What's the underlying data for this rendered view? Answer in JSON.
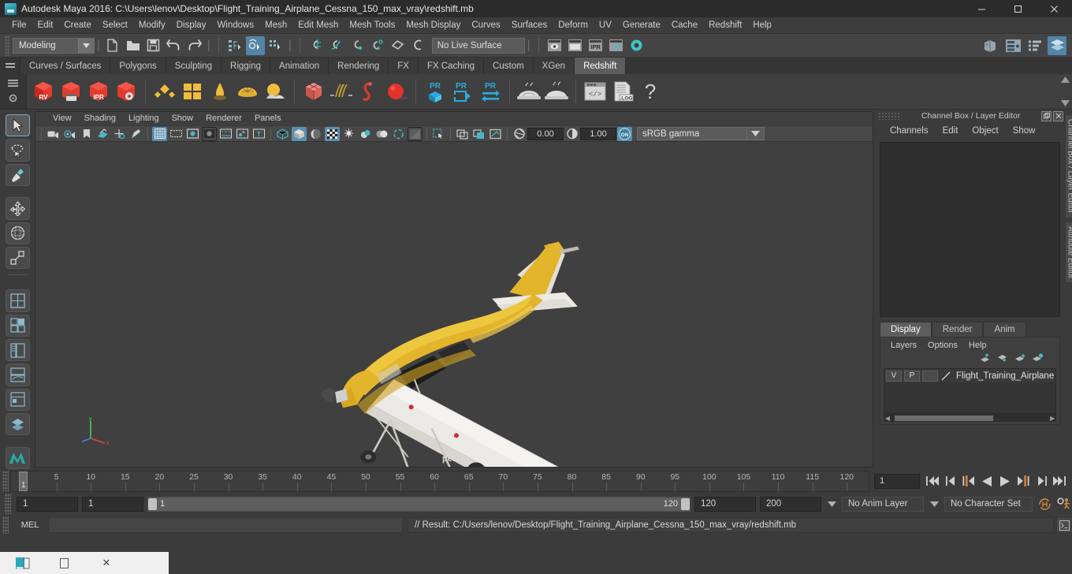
{
  "titlebar": {
    "title": "Autodesk Maya 2016: C:\\Users\\lenov\\Desktop\\Flight_Training_Airplane_Cessna_150_max_vray\\redshift.mb",
    "minimize": "minimize-button",
    "maximize": "maximize-button",
    "close": "close-button"
  },
  "menubar": {
    "items": [
      "File",
      "Edit",
      "Create",
      "Select",
      "Modify",
      "Display",
      "Windows",
      "Mesh",
      "Edit Mesh",
      "Mesh Tools",
      "Mesh Display",
      "Curves",
      "Surfaces",
      "Deform",
      "UV",
      "Generate",
      "Cache",
      "Redshift",
      "Help"
    ]
  },
  "statusbar": {
    "menuset": "Modeling",
    "live_surface": "No Live Surface",
    "icons": [
      "new-scene-icon",
      "open-scene-icon",
      "save-scene-icon",
      "undo-icon",
      "redo-icon",
      "select-by-hierarchy-icon",
      "select-by-object-icon",
      "select-by-component-icon",
      "snap-to-grid-icon",
      "snap-to-curve-icon",
      "snap-to-point-icon",
      "snap-to-projected-center-icon",
      "snap-to-plane-icon",
      "make-live-icon",
      "render-view-icon",
      "render-sequence-icon",
      "ipr-render-icon",
      "render-settings-icon",
      "hypershade-icon"
    ],
    "right_icons": [
      "show-hide-modeling-toolkit-icon",
      "show-hide-attribute-editor-icon",
      "show-hide-tool-settings-icon",
      "show-hide-channel-box-icon"
    ]
  },
  "shelf": {
    "tabs": [
      "Curves / Surfaces",
      "Polygons",
      "Sculpting",
      "Rigging",
      "Animation",
      "Rendering",
      "FX",
      "FX Caching",
      "Custom",
      "XGen",
      "Redshift"
    ],
    "active_tab": "Redshift",
    "icons": [
      "redshift-render-view-icon",
      "redshift-render-sequence-icon",
      "redshift-ipr-icon",
      "redshift-settings-icon",
      "redshift-material-icon",
      "redshift-texture-icon",
      "redshift-light-icon",
      "redshift-dome-light-icon",
      "redshift-sun-sky-icon",
      "redshift-proxy-icon",
      "redshift-hair-icon",
      "redshift-volume-icon",
      "redshift-sphere-icon",
      "redshift-pr-object-icon",
      "redshift-pr-export-icon",
      "redshift-pr-transfer-icon",
      "redshift-bake-icon",
      "redshift-bake-all-icon",
      "redshift-script-icon",
      "redshift-log-icon",
      "redshift-help-icon"
    ],
    "badges": {
      "rv": "RV",
      "ipr": "IPR",
      "pr": "PR",
      "log": ".LOG",
      "help": "?"
    }
  },
  "toolbox": {
    "items": [
      "select-tool",
      "lasso-select-tool",
      "paint-select-tool",
      "move-tool",
      "rotate-tool",
      "scale-tool",
      "last-tool-used",
      "show-manipulator-tool",
      "single-perspective-view-layout",
      "four-view-layout",
      "persp-outliner-layout",
      "persp-graph-layout",
      "hypershade-persp-layout",
      "outliner-persp-layout",
      "maya-logo-icon"
    ]
  },
  "viewport": {
    "menus": [
      "View",
      "Shading",
      "Lighting",
      "Show",
      "Renderer",
      "Panels"
    ],
    "camera_label": "persp",
    "exposure": "0.00",
    "gamma": "1.00",
    "color_management": "sRGB gamma",
    "color_management_toggle": "ON",
    "toolbar_icons": [
      "select-camera-icon",
      "camera-attributes-icon",
      "bookmarks-icon",
      "image-plane-icon",
      "2d-pan-zoom-icon",
      "grease-pencil-icon",
      "grid-toggle-icon",
      "film-gate-icon",
      "resolution-gate-icon",
      "gate-mask-icon",
      "film-origin-icon",
      "exposure-icon",
      "xray-joints-icon",
      "wireframe-shading-icon",
      "smooth-shade-all-icon",
      "smooth-shade-textured-icon",
      "use-all-lights-icon",
      "shadows-icon",
      "screen-space-ambient-occlusion-icon",
      "motion-blur-icon",
      "multisample-anti-aliasing-icon",
      "depth-of-field-icon",
      "isolate-select-icon",
      "xray-icon",
      "xray-active-components-icon",
      "xray-joints-2-icon"
    ]
  },
  "channelbox": {
    "panel_title": "Channel Box / Layer Editor",
    "menus": [
      "Channels",
      "Edit",
      "Object",
      "Show"
    ],
    "side_tabs": [
      "Channel Box / Layer Editor",
      "Attribute Editor"
    ],
    "undock": "undock-button",
    "close": "close-panel-button"
  },
  "layereditor": {
    "tabs": [
      "Display",
      "Render",
      "Anim"
    ],
    "active_tab": "Display",
    "menus": [
      "Layers",
      "Options",
      "Help"
    ],
    "toolbar_icons": [
      "move-layer-up-icon",
      "move-layer-down-icon",
      "new-layer-icon",
      "new-layer-from-selected-icon"
    ],
    "layers": [
      {
        "visibility": "V",
        "playback": "P",
        "shading": "",
        "name": "Flight_Training_Airplane"
      }
    ]
  },
  "timeline": {
    "ticks": [
      5,
      10,
      15,
      20,
      25,
      30,
      35,
      40,
      45,
      50,
      55,
      60,
      65,
      70,
      75,
      80,
      85,
      90,
      95,
      100,
      105,
      110,
      115,
      120
    ],
    "current_frame_marker": "1",
    "current_frame_field": "1",
    "playback_buttons": [
      "go-to-start-icon",
      "step-back-key-icon",
      "step-back-frame-icon",
      "play-backwards-icon",
      "play-forwards-icon",
      "step-forward-frame-icon",
      "step-forward-key-icon",
      "go-to-end-icon"
    ]
  },
  "rangeslider": {
    "anim_start": "1",
    "playback_start": "1",
    "range_left_label": "1",
    "range_right_label": "120",
    "playback_end": "120",
    "anim_end": "200",
    "anim_layer": "No Anim Layer",
    "character_set": "No Character Set",
    "auto_keyframe_icon": "auto-keyframe-icon",
    "anim_prefs_icon": "animation-preferences-icon"
  },
  "commandline": {
    "language": "MEL",
    "input_value": "",
    "result": "// Result: C:/Users/lenov/Desktop/Flight_Training_Airplane_Cessna_150_max_vray/redshift.mb",
    "script_editor_icon": "script-editor-icon"
  },
  "taskbar": {
    "items": [
      "maya-taskbar-icon",
      "window-taskbar-icon",
      "close-taskbar-icon"
    ]
  },
  "colors": {
    "accent": "#5285a6",
    "shelf_red": "#e0352b",
    "shelf_yellow": "#f0bc3c",
    "redshift_blue": "#29abe2",
    "bg_dark": "#3b3b3b",
    "plane_yellow": "#e8b429",
    "plane_white": "#e6e6e6"
  }
}
